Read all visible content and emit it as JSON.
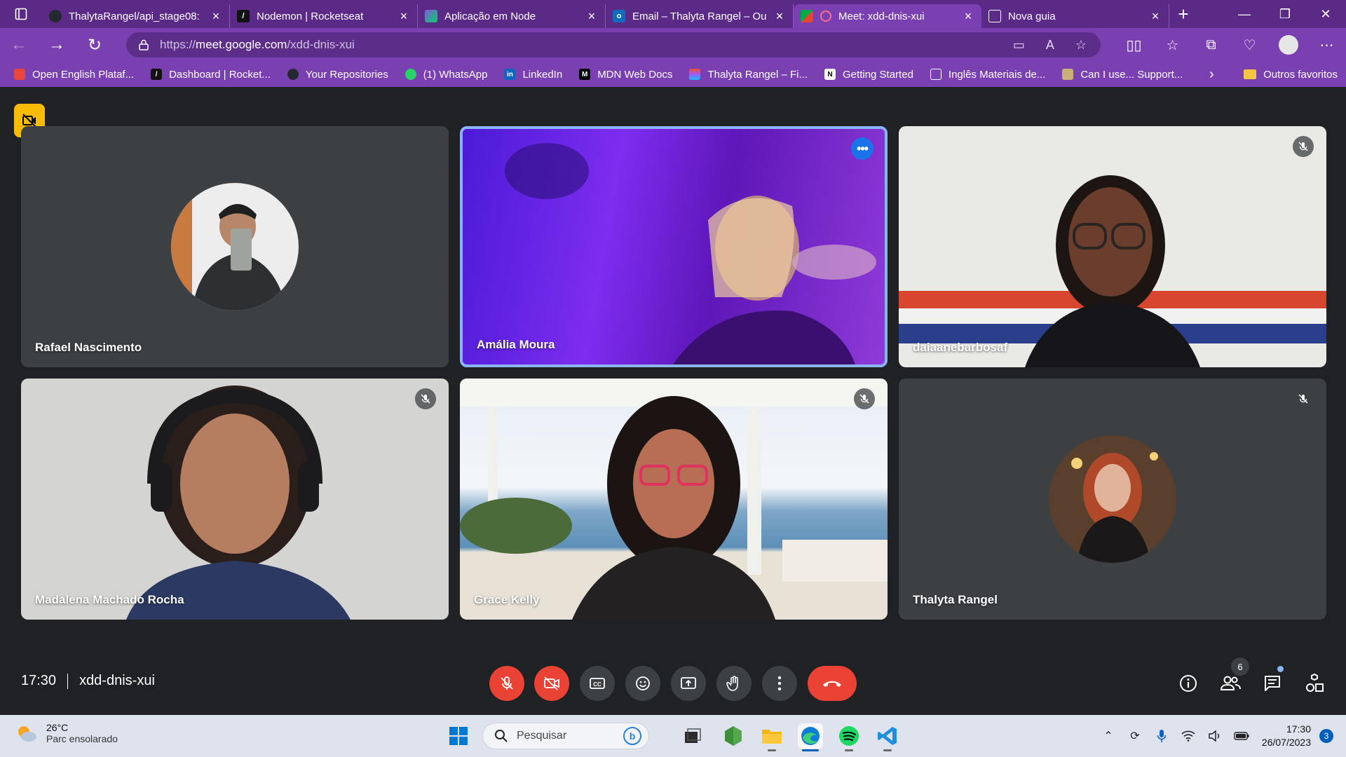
{
  "browser": {
    "tabs": [
      {
        "title": "ThalytaRangel/api_stage08:",
        "icon": "github-icon",
        "color": "#24292f"
      },
      {
        "title": "Nodemon | Rocketseat",
        "icon": "rocketseat-icon",
        "color": "#121214"
      },
      {
        "title": "Aplicação em Node",
        "icon": "rocket-icon",
        "color": "#8257e5"
      },
      {
        "title": "Email – Thalyta Rangel – Ou",
        "icon": "outlook-icon",
        "color": "#0f6cbd"
      },
      {
        "title": "Meet: xdd-dnis-xui",
        "icon": "meet-icon",
        "color": "#00ac47"
      },
      {
        "title": "Nova guia",
        "icon": "new-tab-icon",
        "color": "#ffffff"
      }
    ],
    "url": "https://meet.google.com/xdd-dnis-xui",
    "url_host": "meet.google.com",
    "url_path": "/xdd-dnis-xui",
    "url_scheme": "https://"
  },
  "bookmarks": [
    {
      "label": "Open English Plataf...",
      "icon": "open-english-icon",
      "color": "#e8453c"
    },
    {
      "label": "Dashboard | Rocket...",
      "icon": "rocketseat-icon",
      "color": "#121214"
    },
    {
      "label": "Your Repositories",
      "icon": "github-icon",
      "color": "#24292f"
    },
    {
      "label": "(1) WhatsApp",
      "icon": "whatsapp-icon",
      "color": "#25d366"
    },
    {
      "label": "LinkedIn",
      "icon": "linkedin-icon",
      "color": "#0a66c2"
    },
    {
      "label": "MDN Web Docs",
      "icon": "mdn-icon",
      "color": "#000000"
    },
    {
      "label": "Thalyta Rangel – Fi...",
      "icon": "figma-icon",
      "color": "#a259ff"
    },
    {
      "label": "Getting Started",
      "icon": "notion-icon",
      "color": "#ffffff"
    },
    {
      "label": "Inglês Materiais de...",
      "icon": "document-icon",
      "color": "#ffffff"
    },
    {
      "label": "Can I use... Support...",
      "icon": "caniuse-icon",
      "color": "#c8b078"
    }
  ],
  "bookmarks_other": "Outros favoritos",
  "participants": [
    {
      "name": "Rafael Nascimento",
      "muted": false,
      "type": "avatar"
    },
    {
      "name": "Amália Moura",
      "muted": false,
      "type": "video",
      "speaking": true
    },
    {
      "name": "daiaanebarbosaf",
      "muted": true,
      "type": "video"
    },
    {
      "name": "Madalena Machado Rocha",
      "muted": true,
      "type": "video"
    },
    {
      "name": "Grace Kelly",
      "muted": true,
      "type": "video"
    },
    {
      "name": "Thalyta Rangel",
      "muted": true,
      "type": "avatar"
    }
  ],
  "meeting": {
    "time": "17:30",
    "code": "xdd-dnis-xui",
    "participant_count": "6"
  },
  "colors": {
    "meet_bg": "#202124",
    "tile_bg": "#3c4043",
    "danger": "#ea4335",
    "browser_accent": "#7a3fb0",
    "badge_yellow": "#f9bc06"
  },
  "taskbar": {
    "temperature": "26°C",
    "weather": "Parc ensolarado",
    "search_placeholder": "Pesquisar",
    "clock_time": "17:30",
    "clock_date": "26/07/2023",
    "notification_count": "3"
  }
}
